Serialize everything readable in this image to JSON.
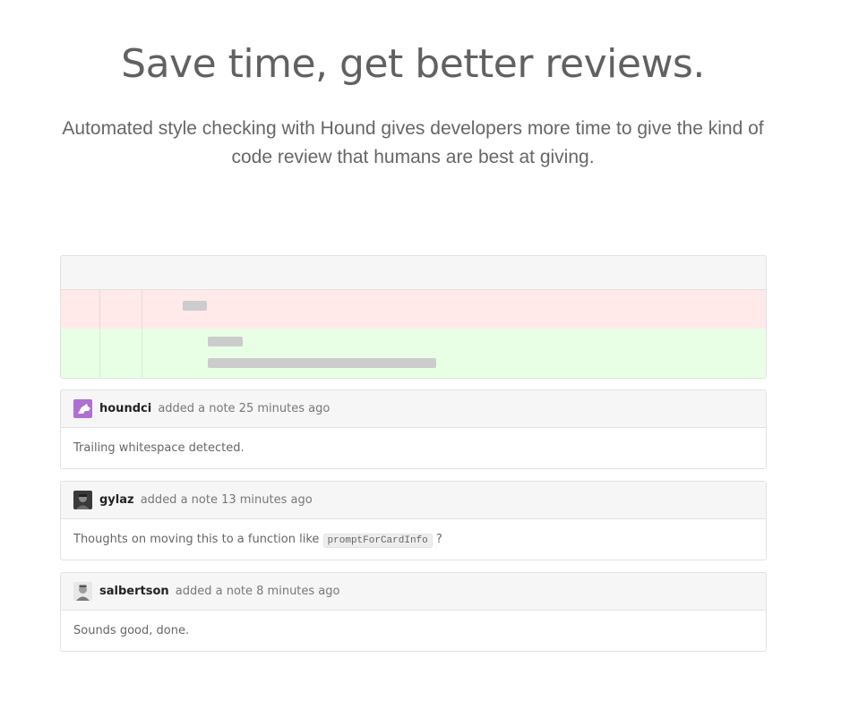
{
  "hero": {
    "title": "Save time, get better reviews.",
    "subtitle": "Automated style checking with Hound gives developers more time to give the kind of code review that humans are best at giving."
  },
  "comments": [
    {
      "user": "houndci",
      "action": "added a note 25 minutes ago",
      "body": "Trailing whitespace detected.",
      "avatar": "hound-logo-icon",
      "avatar_color": "#b06fd3"
    },
    {
      "user": "gylaz",
      "action": "added a note 13 minutes ago",
      "body_before": "Thoughts on moving this to a function like",
      "body_code": "promptForCardInfo",
      "body_after": "?",
      "avatar": "user-photo-icon"
    },
    {
      "user": "salbertson",
      "action": "added a note 8 minutes ago",
      "body": "Sounds good, done.",
      "avatar": "user-photo-icon"
    }
  ],
  "colors": {
    "removed_bg": "#ffe9e9",
    "added_bg": "#e8ffe6",
    "panel_bg": "#f6f6f6",
    "border": "#e2e2e2"
  }
}
